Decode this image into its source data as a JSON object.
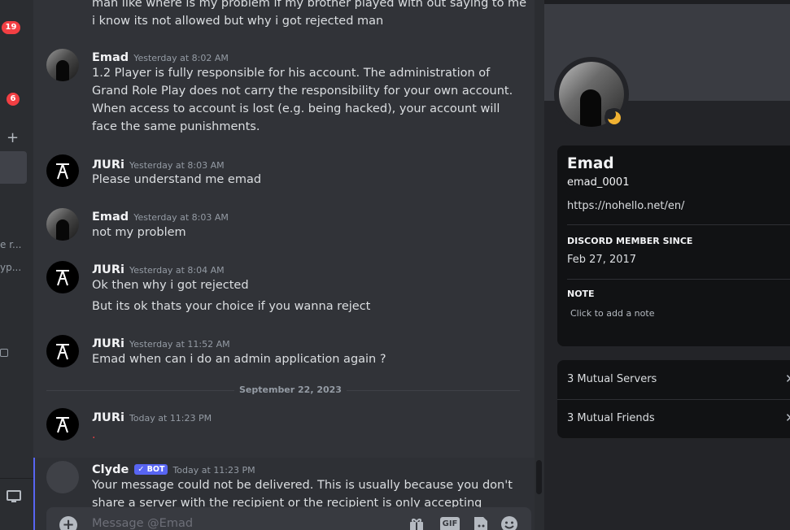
{
  "left": {
    "badges": [
      "19",
      "6"
    ],
    "add_label": "+",
    "fragments": [
      "e r...",
      "yp..."
    ]
  },
  "chat": {
    "top_lines": [
      "man like where is my problem if my brother played with out saying to me",
      "i know its not allowed but why i got rejected man"
    ],
    "messages": [
      {
        "author": "Emad",
        "time": "Yesterday at 8:02 AM",
        "lines": [
          "1.2 Player is fully responsible for his account. The administration of",
          "Grand Role Play does not carry the responsibility for your own account.",
          "When access to account is lost (e.g. being hacked), your account will",
          "face the same punishments."
        ]
      },
      {
        "author": "ЛᑌRi",
        "time": "Yesterday at 8:03 AM",
        "lines": [
          "Please understand me emad"
        ]
      },
      {
        "author": "Emad",
        "time": "Yesterday at 8:03 AM",
        "lines": [
          "not my problem"
        ]
      },
      {
        "author": "ЛᑌRi",
        "time": "Yesterday at 8:04 AM",
        "lines": [
          "Ok then why i got rejected",
          "But its ok thats your choice if you wanna reject"
        ]
      },
      {
        "author": "ЛᑌRi",
        "time": "Yesterday at 11:52 AM",
        "lines": [
          "Emad when can i do an admin application again ?"
        ]
      }
    ],
    "divider_date": "September 22, 2023",
    "today_message": {
      "author": "ЛᑌRi",
      "time": "Today at 11:23 PM",
      "text": "."
    },
    "clyde": {
      "author": "Clyde",
      "bot_tag": "✓ BOT",
      "time": "Today at 11:23 PM",
      "lines": [
        "Your message could not be delivered. This is usually because you don't",
        "share a server with the recipient or the recipient is only accepting"
      ]
    },
    "composer": {
      "placeholder": "Message @Emad",
      "gif_label": "GIF"
    }
  },
  "profile": {
    "display_name": "Emad",
    "username": "emad_0001",
    "bio": "https://nohello.net/en/",
    "member_since_heading": "DISCORD MEMBER SINCE",
    "member_since": "Feb 27, 2017",
    "note_heading": "NOTE",
    "note_placeholder": "Click to add a note",
    "mutual_servers": "3 Mutual Servers",
    "mutual_friends": "3 Mutual Friends"
  },
  "colors": {
    "background": "#313338",
    "panel": "#232428",
    "card": "#111214",
    "accent_blurple": "#5865f2",
    "badge_red": "#f23f43",
    "idle_yellow": "#f0b232"
  },
  "icons": [
    "plus-icon",
    "gift-icon",
    "gif-icon",
    "sticker-icon",
    "emoji-icon",
    "chevron-right-icon",
    "moon-status-icon",
    "monitor-icon"
  ]
}
